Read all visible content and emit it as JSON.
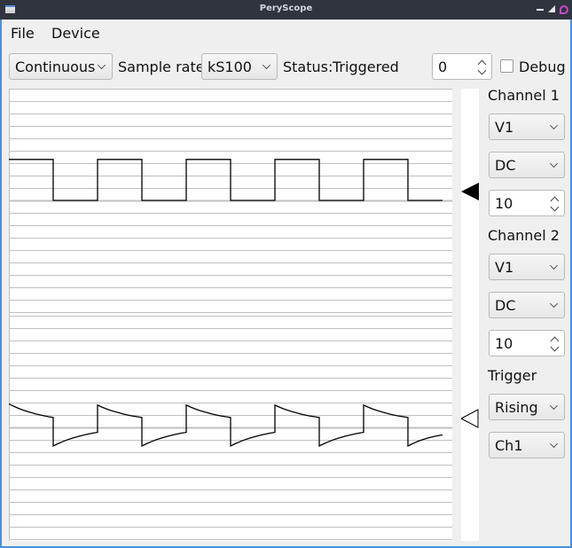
{
  "window": {
    "title": "PeryScope"
  },
  "titlebar": {
    "controls": [
      "minimize-icon",
      "maximize-icon",
      "close-icon"
    ]
  },
  "menu": {
    "items": [
      "File",
      "Device"
    ]
  },
  "toolbar": {
    "mode": "Continuous",
    "sample_rate_label": "Sample rate",
    "sample_rate": "kS100",
    "status_label": "Status:",
    "status_value": "Triggered",
    "offset_value": "0",
    "debug_label": "Debug",
    "debug_checked": false
  },
  "channel1": {
    "label": "Channel 1",
    "range": "V1",
    "coupling": "DC",
    "scale": "10"
  },
  "channel2": {
    "label": "Channel 2",
    "range": "V1",
    "coupling": "DC",
    "scale": "10"
  },
  "trigger": {
    "label": "Trigger",
    "edge": "Rising",
    "source": "Ch1"
  },
  "colors": {
    "titlebar": "#2f343f",
    "border": "#4a8fdc",
    "grid": "#c0c0c0",
    "trace": "#000000",
    "close": "#c64bc6"
  },
  "chart_data": {
    "type": "line",
    "title": "",
    "grid": true,
    "panels": [
      {
        "name": "Channel 1",
        "waveform": "square",
        "grid_divisions": 18,
        "ylim": [
          -9,
          9
        ],
        "center_division": 9,
        "period_samples": 100,
        "x": [
          0,
          50,
          50,
          100,
          100,
          150,
          150,
          200,
          200,
          250,
          250,
          300,
          300,
          350,
          350,
          400,
          400,
          450,
          450,
          489
        ],
        "y": [
          3.3,
          3.3,
          0,
          0,
          3.3,
          3.3,
          0,
          0,
          3.3,
          3.3,
          0,
          0,
          3.3,
          3.3,
          0,
          0,
          3.3,
          3.3,
          0,
          0
        ],
        "trigger_level": 0
      },
      {
        "name": "Channel 2",
        "waveform": "ac-coupled square (RC decay)",
        "grid_divisions": 18,
        "ylim": [
          -9,
          9
        ],
        "center_division": 9,
        "x": [
          0,
          50,
          50,
          100,
          100,
          150,
          150,
          200,
          200,
          250,
          250,
          300,
          300,
          350,
          350,
          400,
          400,
          450,
          450,
          489
        ],
        "y": [
          1.9,
          0.8,
          -1.5,
          -0.4,
          1.8,
          0.8,
          -1.5,
          -0.4,
          1.8,
          0.8,
          -1.5,
          -0.4,
          1.8,
          0.8,
          -1.5,
          -0.4,
          1.8,
          0.8,
          -1.5,
          -0.6
        ],
        "trigger_level": 0.7
      }
    ]
  }
}
